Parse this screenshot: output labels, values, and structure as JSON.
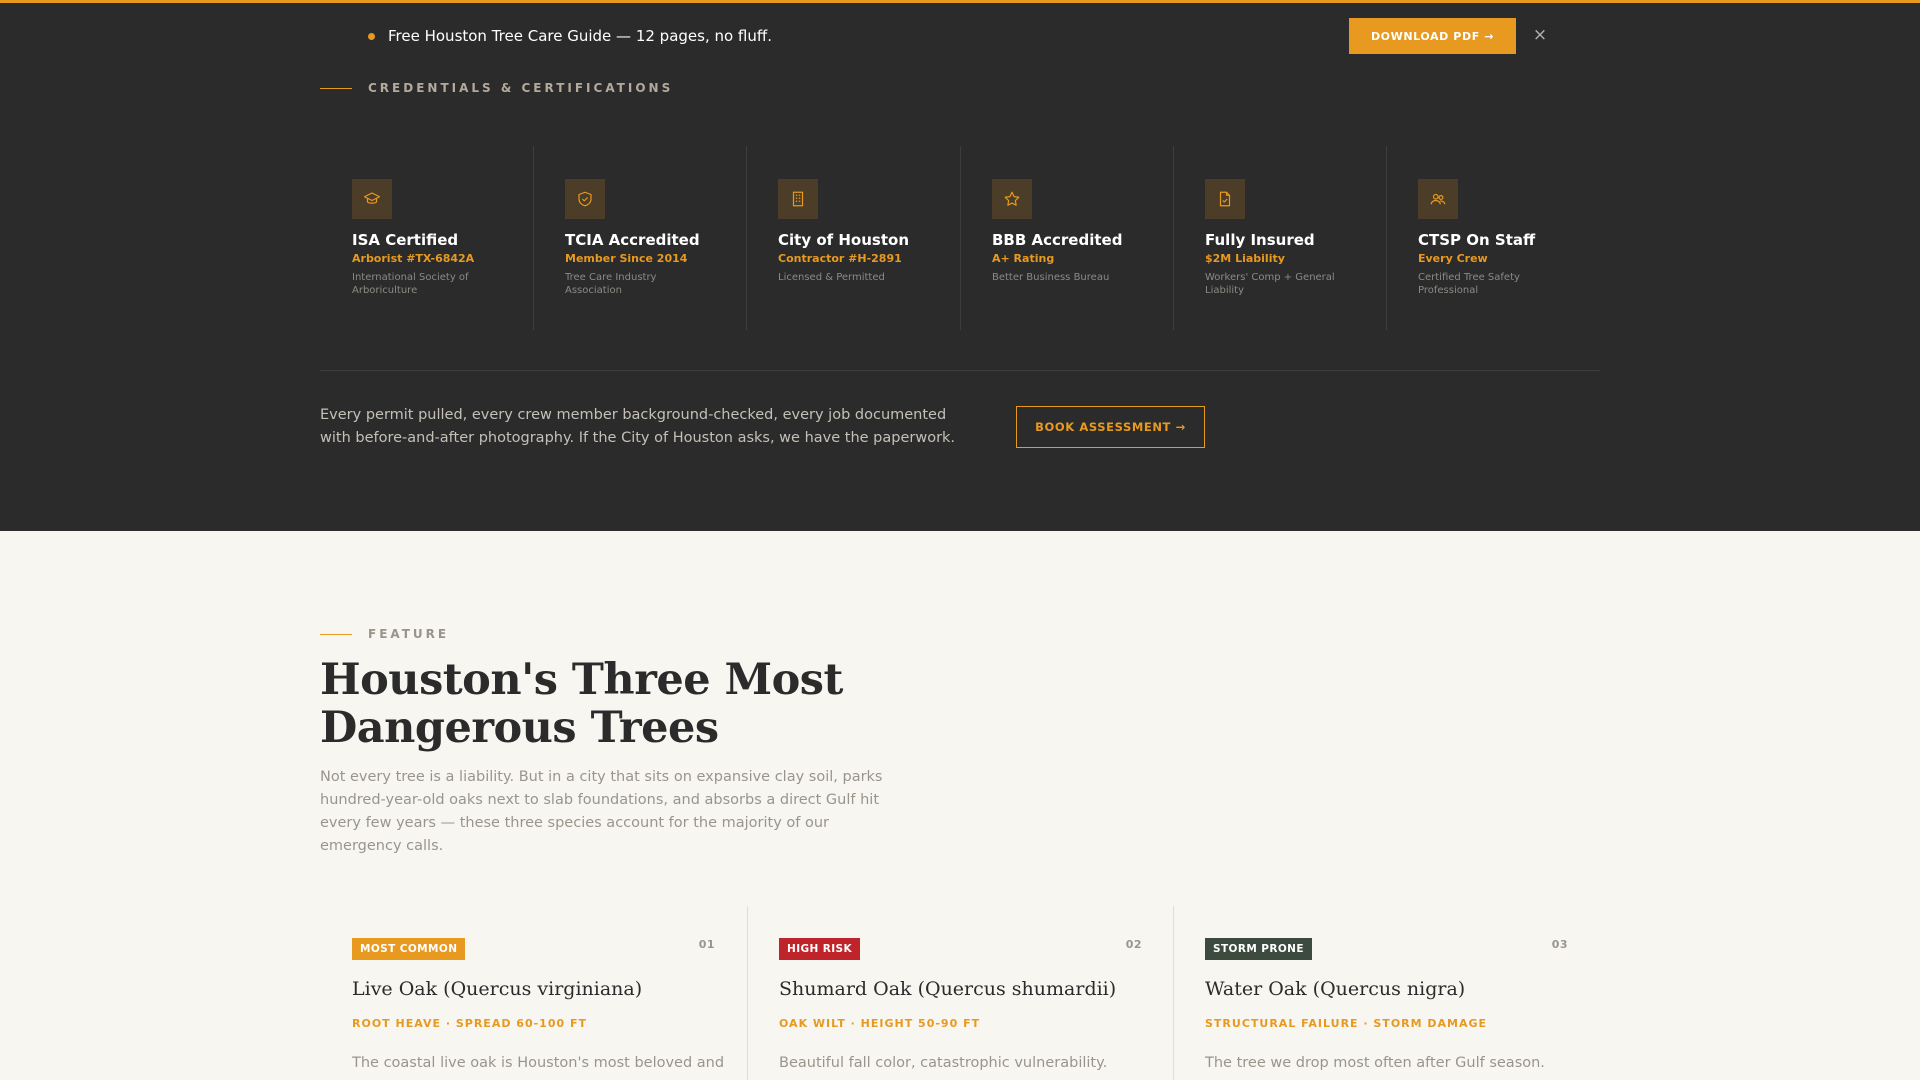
{
  "promo": {
    "text": "Free Houston Tree Care Guide — 12 pages, no fluff.",
    "button_label": "DOWNLOAD PDF →",
    "close_label": "×"
  },
  "credentials": {
    "eyebrow": "CREDENTIALS & CERTIFICATIONS",
    "items": [
      {
        "icon": "graduation-cap-icon",
        "title": "ISA Certified",
        "subtitle": "Arborist #TX-6842A",
        "description": "International Society of Arboriculture"
      },
      {
        "icon": "shield-check-icon",
        "title": "TCIA Accredited",
        "subtitle": "Member Since 2014",
        "description": "Tree Care Industry Association"
      },
      {
        "icon": "building-icon",
        "title": "City of Houston",
        "subtitle": "Contractor #H-2891",
        "description": "Licensed & Permitted"
      },
      {
        "icon": "star-icon",
        "title": "BBB Accredited",
        "subtitle": "A+ Rating",
        "description": "Better Business Bureau"
      },
      {
        "icon": "document-check-icon",
        "title": "Fully Insured",
        "subtitle": "$2M Liability",
        "description": "Workers' Comp + General Liability"
      },
      {
        "icon": "team-icon",
        "title": "CTSP On Staff",
        "subtitle": "Every Crew",
        "description": "Certified Tree Safety Professional"
      }
    ],
    "statement": "Every permit pulled, every crew member background-checked, every job documented with before-and-after photography. If the City of Houston asks, we have the paperwork.",
    "cta_label": "BOOK ASSESSMENT →"
  },
  "feature": {
    "eyebrow": "FEATURE",
    "title": "Houston's Three Most Dangerous Trees",
    "intro": "Not every tree is a liability. But in a city that sits on expansive clay soil, parks hundred-year-old oaks next to slab foundations, and absorbs a direct Gulf hit every few years — these three species account for the majority of our emergency calls.",
    "trees": [
      {
        "badge": "MOST COMMON",
        "badge_color": "#e8991f",
        "number": "01",
        "name": "Live Oak (Quercus virginiana)",
        "meta": "ROOT HEAVE · SPREAD 60-100 FT",
        "description": "The coastal live oak is Houston's most beloved and"
      },
      {
        "badge": "HIGH RISK",
        "badge_color": "#c0242b",
        "number": "02",
        "name": "Shumard Oak (Quercus shumardii)",
        "meta": "OAK WILT · HEIGHT 50-90 FT",
        "description": "Beautiful fall color, catastrophic vulnerability."
      },
      {
        "badge": "STORM PRONE",
        "badge_color": "#3d4a3e",
        "number": "03",
        "name": "Water Oak (Quercus nigra)",
        "meta": "STRUCTURAL FAILURE · STORM DAMAGE",
        "description": "The tree we drop most often after Gulf season."
      }
    ]
  },
  "colors": {
    "accent": "#e8991f",
    "dark_bg": "#2b2b2b",
    "light_bg": "#f8f6f1"
  }
}
